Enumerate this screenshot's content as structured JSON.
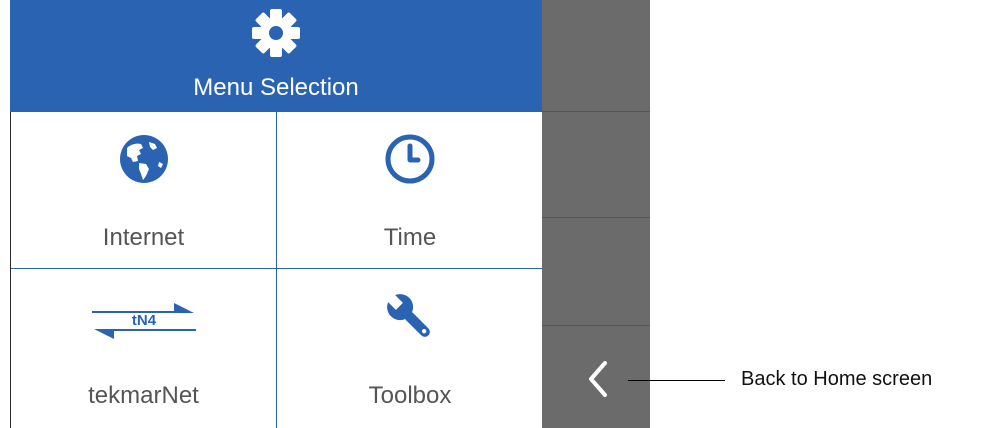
{
  "colors": {
    "accent": "#2a63b2",
    "sidebar": "#6b6b6b"
  },
  "header": {
    "title": "Menu Selection",
    "icon": "gear-icon"
  },
  "menu": [
    {
      "label": "Internet",
      "icon": "globe-icon"
    },
    {
      "label": "Time",
      "icon": "clock-icon"
    },
    {
      "label": "tekmarNet",
      "icon": "tekmarnet-icon",
      "icon_text": "tN4"
    },
    {
      "label": "Toolbox",
      "icon": "wrench-icon"
    }
  ],
  "sidebar": {
    "back_icon": "chevron-left-icon"
  },
  "callout": {
    "text": "Back to Home screen"
  }
}
